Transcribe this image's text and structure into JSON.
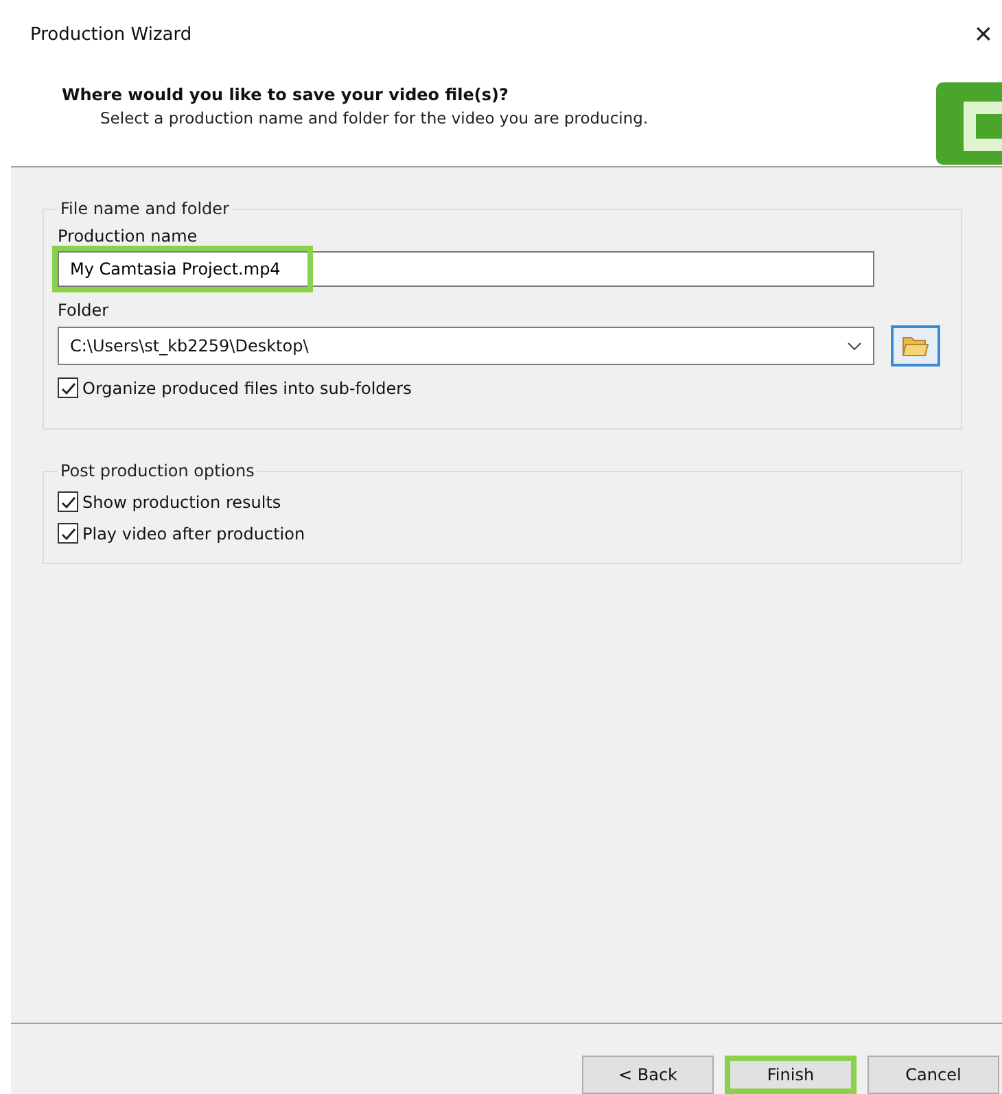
{
  "window": {
    "title": "Production Wizard",
    "close": "×"
  },
  "header": {
    "heading": "Where would you like to save your video file(s)?",
    "subheading": "Select a production name and folder for the video you are producing."
  },
  "file_group": {
    "legend": "File name and folder",
    "name_label": "Production name",
    "name_value": "My Camtasia Project.mp4",
    "name_highlighted": true,
    "folder_label": "Folder",
    "folder_value": "C:\\Users\\st_kb2259\\Desktop\\",
    "organize": {
      "label": "Organize produced files into sub-folders",
      "checked": true
    }
  },
  "post_group": {
    "legend": "Post production options",
    "options": [
      {
        "label": "Show production results",
        "checked": true
      },
      {
        "label": "Play video after production",
        "checked": true
      }
    ]
  },
  "buttons": [
    {
      "label": "< Back",
      "highlighted": false
    },
    {
      "label": "Finish",
      "highlighted": true
    },
    {
      "label": "Cancel",
      "highlighted": false
    }
  ]
}
